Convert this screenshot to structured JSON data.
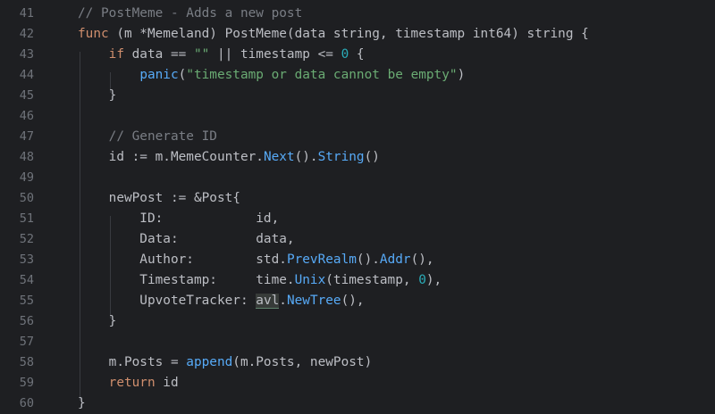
{
  "editor": {
    "lines": [
      {
        "num": "41",
        "tokens": [
          {
            "t": "// PostMeme - Adds a new post",
            "c": "cm"
          }
        ]
      },
      {
        "num": "42",
        "tokens": [
          {
            "t": "func",
            "c": "kw"
          },
          {
            "t": " (m *Memeland) PostMeme(data ",
            "c": "id"
          },
          {
            "t": "string",
            "c": "id"
          },
          {
            "t": ", timestamp ",
            "c": "id"
          },
          {
            "t": "int64",
            "c": "id"
          },
          {
            "t": ") ",
            "c": "id"
          },
          {
            "t": "string",
            "c": "id"
          },
          {
            "t": " {",
            "c": "id"
          }
        ]
      },
      {
        "num": "43",
        "tokens": [
          {
            "t": "    ",
            "c": "id"
          },
          {
            "t": "if",
            "c": "kw"
          },
          {
            "t": " data == ",
            "c": "id"
          },
          {
            "t": "\"\"",
            "c": "str"
          },
          {
            "t": " || timestamp <= ",
            "c": "id"
          },
          {
            "t": "0",
            "c": "num"
          },
          {
            "t": " {",
            "c": "id"
          }
        ]
      },
      {
        "num": "44",
        "tokens": [
          {
            "t": "        ",
            "c": "id"
          },
          {
            "t": "panic",
            "c": "fn"
          },
          {
            "t": "(",
            "c": "id"
          },
          {
            "t": "\"timestamp or data cannot be empty\"",
            "c": "str"
          },
          {
            "t": ")",
            "c": "id"
          }
        ]
      },
      {
        "num": "45",
        "tokens": [
          {
            "t": "    }",
            "c": "id"
          }
        ]
      },
      {
        "num": "46",
        "tokens": []
      },
      {
        "num": "47",
        "tokens": [
          {
            "t": "    ",
            "c": "id"
          },
          {
            "t": "// Generate ID",
            "c": "cm"
          }
        ]
      },
      {
        "num": "48",
        "tokens": [
          {
            "t": "    id := m.MemeCounter.",
            "c": "id"
          },
          {
            "t": "Next",
            "c": "fn"
          },
          {
            "t": "().",
            "c": "id"
          },
          {
            "t": "String",
            "c": "fn"
          },
          {
            "t": "()",
            "c": "id"
          }
        ]
      },
      {
        "num": "49",
        "tokens": []
      },
      {
        "num": "50",
        "tokens": [
          {
            "t": "    newPost := &Post{",
            "c": "id"
          }
        ]
      },
      {
        "num": "51",
        "tokens": [
          {
            "t": "        ID:            id,",
            "c": "id"
          }
        ]
      },
      {
        "num": "52",
        "tokens": [
          {
            "t": "        Data:          data,",
            "c": "id"
          }
        ]
      },
      {
        "num": "53",
        "tokens": [
          {
            "t": "        Author:        std.",
            "c": "id"
          },
          {
            "t": "PrevRealm",
            "c": "fn"
          },
          {
            "t": "().",
            "c": "id"
          },
          {
            "t": "Addr",
            "c": "fn"
          },
          {
            "t": "(),",
            "c": "id"
          }
        ]
      },
      {
        "num": "54",
        "tokens": [
          {
            "t": "        Timestamp:     time.",
            "c": "id"
          },
          {
            "t": "Unix",
            "c": "fn"
          },
          {
            "t": "(timestamp, ",
            "c": "id"
          },
          {
            "t": "0",
            "c": "num"
          },
          {
            "t": "),",
            "c": "id"
          }
        ]
      },
      {
        "num": "55",
        "tokens": [
          {
            "t": "        UpvoteTracker: ",
            "c": "id"
          },
          {
            "t": "avl",
            "c": "hl"
          },
          {
            "t": ".",
            "c": "id"
          },
          {
            "t": "NewTree",
            "c": "fn"
          },
          {
            "t": "(),",
            "c": "id"
          }
        ]
      },
      {
        "num": "56",
        "tokens": [
          {
            "t": "    }",
            "c": "id"
          }
        ]
      },
      {
        "num": "57",
        "tokens": []
      },
      {
        "num": "58",
        "tokens": [
          {
            "t": "    m.Posts = ",
            "c": "id"
          },
          {
            "t": "append",
            "c": "fn"
          },
          {
            "t": "(m.Posts, newPost)",
            "c": "id"
          }
        ]
      },
      {
        "num": "59",
        "tokens": [
          {
            "t": "    ",
            "c": "id"
          },
          {
            "t": "return",
            "c": "kw"
          },
          {
            "t": " id",
            "c": "id"
          }
        ]
      },
      {
        "num": "60",
        "tokens": [
          {
            "t": "}",
            "c": "id"
          }
        ]
      }
    ]
  }
}
